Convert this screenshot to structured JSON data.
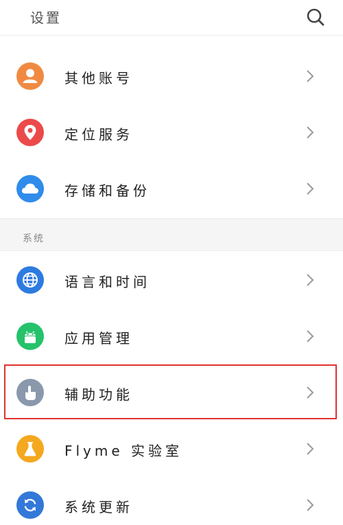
{
  "header": {
    "title": "设置",
    "search_icon": "search-icon"
  },
  "accounts_group": [
    {
      "label": "其他账号",
      "icon": "person-icon",
      "color": "#F08A42"
    },
    {
      "label": "定位服务",
      "icon": "location-pin-icon",
      "color": "#EB4A4A"
    },
    {
      "label": "存储和备份",
      "icon": "cloud-icon",
      "color": "#2F8CEB"
    }
  ],
  "section": {
    "label": "系统"
  },
  "system_group": [
    {
      "label": "语言和时间",
      "icon": "globe-icon",
      "color": "#2E7BE0"
    },
    {
      "label": "应用管理",
      "icon": "android-icon",
      "color": "#25C26B"
    },
    {
      "label": "辅助功能",
      "icon": "hand-pointer-icon",
      "color": "#8A98AC",
      "highlighted": true
    },
    {
      "label": "Flyme 实验室",
      "icon": "flask-icon",
      "color": "#F4A81E"
    },
    {
      "label": "系统更新",
      "icon": "refresh-icon",
      "color": "#3378D9"
    }
  ],
  "colors": {
    "highlight_border": "#E0322F",
    "section_bg": "#F5F5F5",
    "chevron": "#9A9A9A"
  }
}
